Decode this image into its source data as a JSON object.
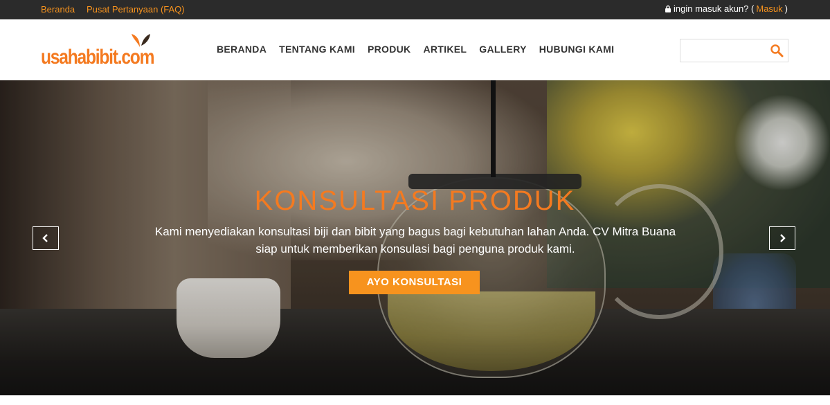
{
  "topbar": {
    "links": [
      "Beranda",
      "Pusat Pertanyaan (FAQ)"
    ],
    "login_prefix": "ingin masuk akun? (",
    "login_link": "Masuk",
    "login_suffix": ")",
    "lock_icon": "lock-icon"
  },
  "brand": {
    "logo_text": "usahabibit.com",
    "accent_color": "#f47a20"
  },
  "nav": {
    "items": [
      "BERANDA",
      "TENTANG KAMI",
      "PRODUK",
      "ARTIKEL",
      "GALLERY",
      "HUBUNGI KAMI"
    ]
  },
  "search": {
    "value": "",
    "placeholder": "",
    "icon": "search-icon"
  },
  "hero": {
    "title": "KONSULTASI PRODUK",
    "description": "Kami menyediakan konsultasi biji dan bibit yang bagus bagi kebutuhan lahan Anda. CV Mitra Buana siap untuk memberikan konsulasi bagi penguna produk kami.",
    "cta_label": "AYO KONSULTASI",
    "cta_color": "#f7931e",
    "prev_icon": "chevron-left-icon",
    "next_icon": "chevron-right-icon"
  }
}
